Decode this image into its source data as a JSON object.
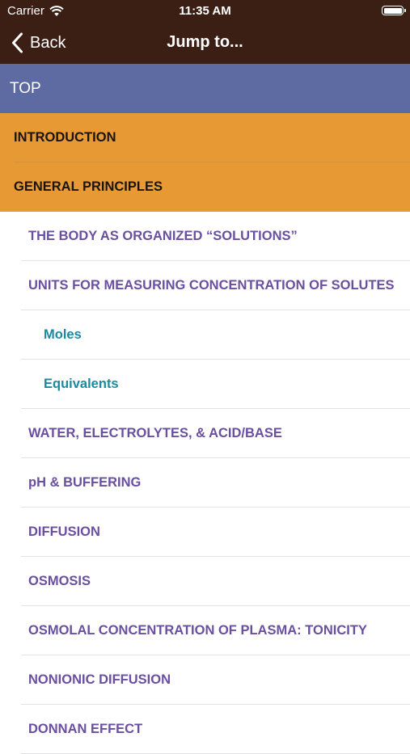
{
  "status": {
    "carrier": "Carrier",
    "time": "11:35 AM"
  },
  "nav": {
    "back_label": "Back",
    "title": "Jump to..."
  },
  "items": [
    "TOP",
    "INTRODUCTION",
    "GENERAL PRINCIPLES",
    "THE BODY AS ORGANIZED “SOLUTIONS”",
    "UNITS FOR MEASURING CONCENTRATION OF SOLUTES",
    "Moles",
    "Equivalents",
    "WATER, ELECTROLYTES, & ACID/BASE",
    "pH & BUFFERING",
    "DIFFUSION",
    "OSMOSIS",
    "OSMOLAL CONCENTRATION OF PLASMA: TONICITY",
    "NONIONIC DIFFUSION",
    "DONNAN EFFECT"
  ],
  "colors": {
    "nav_bg": "#3c1f14",
    "top_row": "#5e6ba3",
    "section_row": "#e79a34",
    "level1_text": "#6a4fa0",
    "level2_text": "#1b8aa0"
  }
}
